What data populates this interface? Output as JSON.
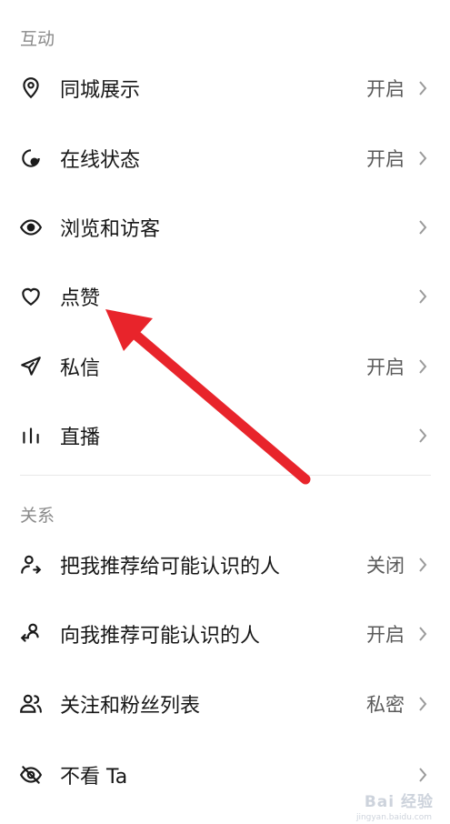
{
  "sections": {
    "interaction_title": "互动",
    "relations_title": "关系"
  },
  "interaction_items": [
    {
      "icon": "location-pin-icon",
      "label": "同城展示",
      "value": "开启"
    },
    {
      "icon": "online-status-icon",
      "label": "在线状态",
      "value": "开启"
    },
    {
      "icon": "eye-icon",
      "label": "浏览和访客",
      "value": ""
    },
    {
      "icon": "heart-icon",
      "label": "点赞",
      "value": ""
    },
    {
      "icon": "send-icon",
      "label": "私信",
      "value": "开启"
    },
    {
      "icon": "live-bars-icon",
      "label": "直播",
      "value": ""
    }
  ],
  "relation_items": [
    {
      "icon": "user-share-icon",
      "label": "把我推荐给可能认识的人",
      "value": "关闭"
    },
    {
      "icon": "user-recommend-icon",
      "label": "向我推荐可能认识的人",
      "value": "开启"
    },
    {
      "icon": "users-icon",
      "label": "关注和粉丝列表",
      "value": "私密"
    },
    {
      "icon": "eye-off-icon",
      "label": "不看 Ta",
      "value": ""
    }
  ],
  "annotation": {
    "color": "#e8242b",
    "target": "点赞"
  },
  "watermark": {
    "text": "Bai 经验",
    "sub": "jingyan.baidu.com"
  }
}
